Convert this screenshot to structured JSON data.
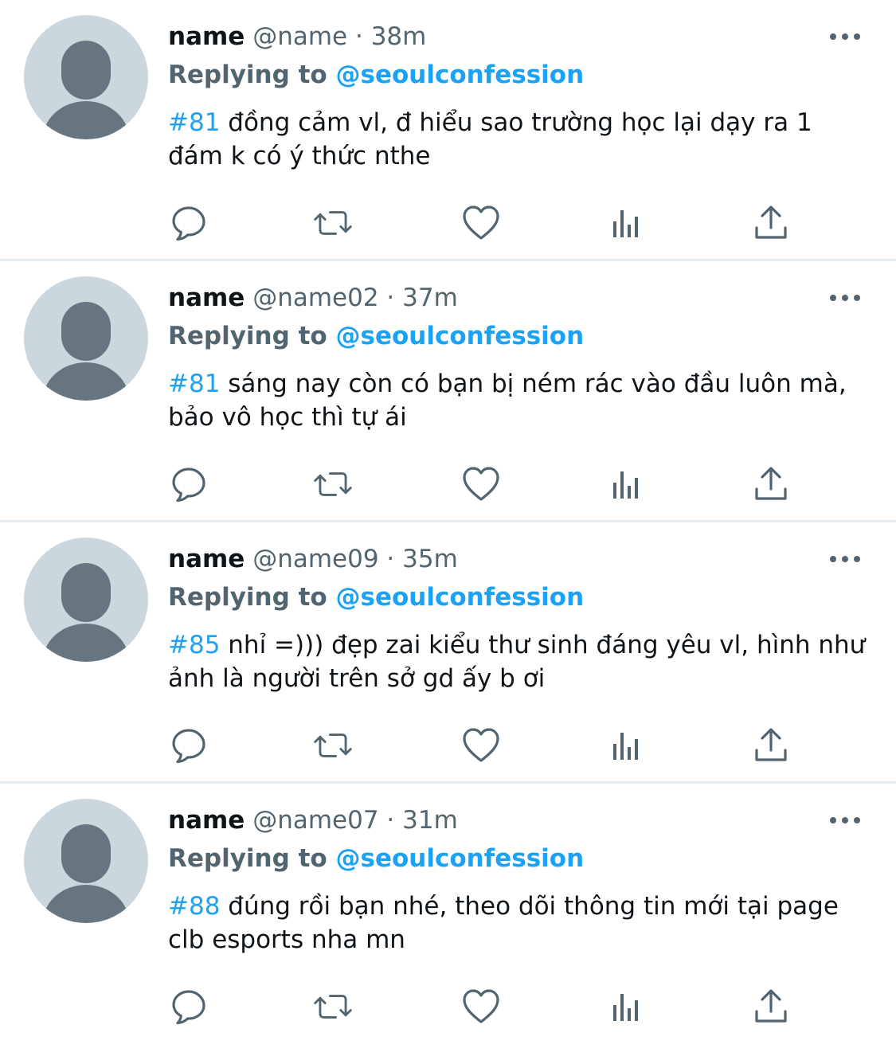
{
  "replying_label": "Replying to",
  "tweets": [
    {
      "display_name": "name",
      "handle": "@name",
      "separator": "·",
      "time": "38m",
      "replying_to": "@seoulconfession",
      "hashtag": "#81",
      "text": "đồng cảm vl, đ hiểu sao trường học lại dạy ra 1 đám k có ý thức nthe"
    },
    {
      "display_name": "name",
      "handle": "@name02",
      "separator": "·",
      "time": "37m",
      "replying_to": "@seoulconfession",
      "hashtag": "#81",
      "text": "sáng nay còn có bạn bị ném rác vào đầu luôn mà, bảo vô học thì tự ái"
    },
    {
      "display_name": "name",
      "handle": "@name09",
      "separator": "·",
      "time": "35m",
      "replying_to": "@seoulconfession",
      "hashtag": "#85",
      "text": "nhỉ =))) đẹp zai kiểu thư sinh đáng yêu vl, hình như ảnh là người trên sở gd ấy b ơi"
    },
    {
      "display_name": "name",
      "handle": "@name07",
      "separator": "·",
      "time": "31m",
      "replying_to": "@seoulconfession",
      "hashtag": "#88",
      "text": "đúng rồi bạn nhé, theo dõi thông tin mới tại page clb esports nha mn"
    }
  ],
  "icons": [
    "reply-icon",
    "retweet-icon",
    "like-icon",
    "analytics-icon",
    "share-icon",
    "more-options-icon"
  ],
  "colors": {
    "accent": "#1da1f2",
    "secondary_text": "#536471",
    "primary_text": "#0f1419",
    "avatar_bg": "#ccd6dd",
    "avatar_fg": "#66757f",
    "divider": "#e6ecf0"
  }
}
